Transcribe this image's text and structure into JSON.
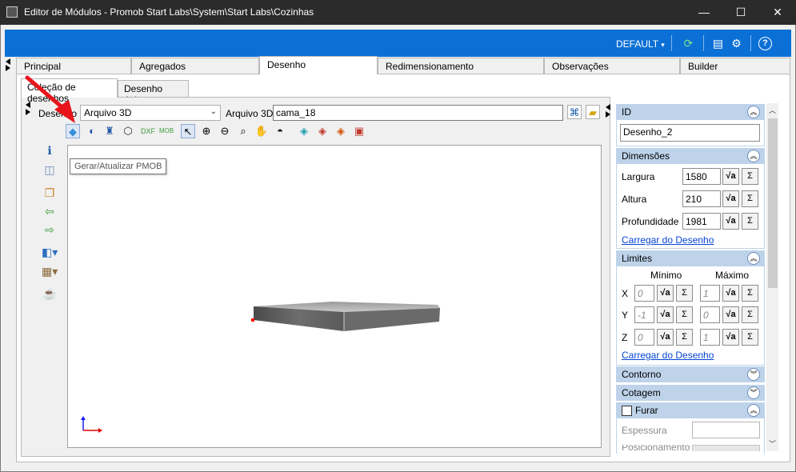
{
  "window": {
    "title": "Editor de Módulos - Promob Start Labs\\System\\Start Labs\\Cozinhas",
    "minimize": "—",
    "maximize": "☐",
    "close": "✕"
  },
  "toolbar": {
    "preset": "DEFAULT",
    "preset_arrow": "▾",
    "icons": [
      "refresh-icon",
      "list-icon",
      "settings-icon",
      "help-icon"
    ]
  },
  "tabs": [
    "Principal",
    "Agregados",
    "Desenho",
    "Redimensionamento",
    "Observações",
    "Builder"
  ],
  "subtabs": [
    "Coleção de desenhos",
    "Desenho único"
  ],
  "desenho": {
    "label": "Desenho",
    "type_value": "Arquivo 3D",
    "file_label": "Arquivo 3D",
    "file_value": "cama_18"
  },
  "tooltip": "Gerar/Atualizar PMOB",
  "properties": {
    "id": {
      "title": "ID",
      "value": "Desenho_2"
    },
    "dimensoes": {
      "title": "Dimensões",
      "largura_label": "Largura",
      "largura": "1580",
      "altura_label": "Altura",
      "altura": "210",
      "profundidade_label": "Profundidade",
      "profundidade": "1981",
      "link": "Carregar do Desenho"
    },
    "limites": {
      "title": "Limites",
      "min_label": "Mínimo",
      "max_label": "Máximo",
      "x_label": "X",
      "x_min": "0",
      "x_max": "1",
      "y_label": "Y",
      "y_min": "-1",
      "y_max": "0",
      "z_label": "Z",
      "z_min": "0",
      "z_max": "1",
      "link": "Carregar do Desenho"
    },
    "contorno": {
      "title": "Contorno"
    },
    "cotagem": {
      "title": "Cotagem"
    },
    "furar": {
      "title": "Furar",
      "espessura_label": "Espessura",
      "posicionamento_label": "Posicionamento"
    },
    "formula_btn": "√a",
    "sum_btn": "Σ"
  },
  "colors": {
    "accent": "#0b70d6",
    "section": "#bed3ea",
    "titlebar": "#2b2b2b",
    "annotation_arrow": "#e8141b"
  }
}
